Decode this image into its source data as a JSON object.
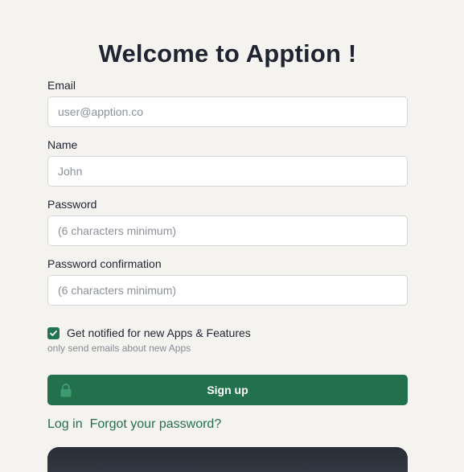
{
  "page": {
    "title": "Welcome to Apption !"
  },
  "form": {
    "email": {
      "label": "Email",
      "placeholder": "user@apption.co",
      "value": ""
    },
    "name": {
      "label": "Name",
      "placeholder": "John",
      "value": ""
    },
    "password": {
      "label": "Password",
      "placeholder": "(6 characters minimum)",
      "value": ""
    },
    "password_confirmation": {
      "label": "Password confirmation",
      "placeholder": "(6 characters minimum)",
      "value": ""
    },
    "notify": {
      "label": "Get notified for new Apps & Features",
      "help": "only send emails about new Apps",
      "checked": true
    },
    "submit": {
      "label": "Sign up",
      "icon": "lock-icon"
    }
  },
  "links": {
    "log_in": "Log in",
    "forgot_password": "Forgot your password?"
  },
  "colors": {
    "background": "#f5f3f0",
    "accent": "#22704c",
    "text": "#1f2430",
    "muted": "#858a93"
  }
}
